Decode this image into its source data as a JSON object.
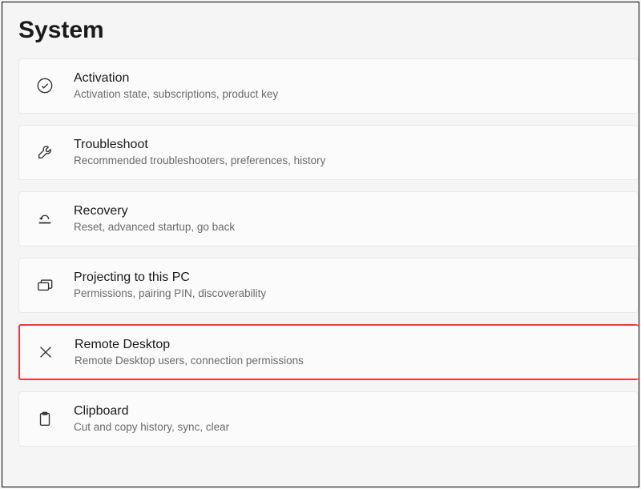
{
  "page": {
    "title": "System"
  },
  "items": [
    {
      "title": "Activation",
      "subtitle": "Activation state, subscriptions, product key",
      "highlighted": false
    },
    {
      "title": "Troubleshoot",
      "subtitle": "Recommended troubleshooters, preferences, history",
      "highlighted": false
    },
    {
      "title": "Recovery",
      "subtitle": "Reset, advanced startup, go back",
      "highlighted": false
    },
    {
      "title": "Projecting to this PC",
      "subtitle": "Permissions, pairing PIN, discoverability",
      "highlighted": false
    },
    {
      "title": "Remote Desktop",
      "subtitle": "Remote Desktop users, connection permissions",
      "highlighted": true
    },
    {
      "title": "Clipboard",
      "subtitle": "Cut and copy history, sync, clear",
      "highlighted": false
    }
  ]
}
